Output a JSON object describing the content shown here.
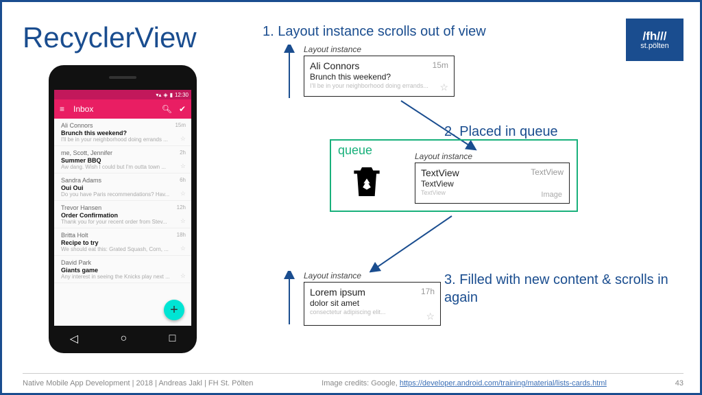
{
  "slide": {
    "title": "RecyclerView",
    "logo_top": "/fh///",
    "logo_bottom": "st.pölten",
    "page_number": "43",
    "footer_left": "Native Mobile App Development | 2018 | Andreas Jakl | FH St. Pölten",
    "footer_right_prefix": "Image credits: Google, ",
    "footer_link": "https://developer.android.com/training/material/lists-cards.html"
  },
  "steps": {
    "s1": "1. Layout instance scrolls out of view",
    "s2": "2. Placed in queue",
    "s3": "3. Filled with new content & scrolls in again"
  },
  "layout_label": "Layout instance",
  "queue_label": "queue",
  "card1": {
    "name": "Ali Connors",
    "time": "15m",
    "subject": "Brunch this weekend?",
    "preview": "I'll be in your neighborhood doing errands..."
  },
  "card2": {
    "tl": "TextView",
    "tr": "TextView",
    "ml": "TextView",
    "bl": "TextView",
    "br": "Image"
  },
  "card3": {
    "name": "Lorem ipsum",
    "time": "17h",
    "subject": "dolor sit amet",
    "preview": "consectetur adipiscing elit..."
  },
  "phone": {
    "status_time": "12:30",
    "app_title": "Inbox",
    "rows": [
      {
        "from": "Ali Connors",
        "subject": "Brunch this weekend?",
        "preview": "I'll be in your neighborhood doing errands ...",
        "time": "15m"
      },
      {
        "from": "me, Scott, Jennifer",
        "subject": "Summer BBQ",
        "preview": "Aw dang. Wish I could but I'm outta town ...",
        "time": "2h"
      },
      {
        "from": "Sandra Adams",
        "subject": "Oui Oui",
        "preview": "Do you have Paris recommendations? Hav...",
        "time": "6h"
      },
      {
        "from": "Trevor Hansen",
        "subject": "Order Confirmation",
        "preview": "Thank you for your recent order from Stev...",
        "time": "12h"
      },
      {
        "from": "Britta Holt",
        "subject": "Recipe to try",
        "preview": "We should eat this: Grated Squash, Corn, ...",
        "time": "18h"
      },
      {
        "from": "David Park",
        "subject": "Giants game",
        "preview": "Any interest in seeing the Knicks play next ...",
        "time": ""
      }
    ]
  }
}
